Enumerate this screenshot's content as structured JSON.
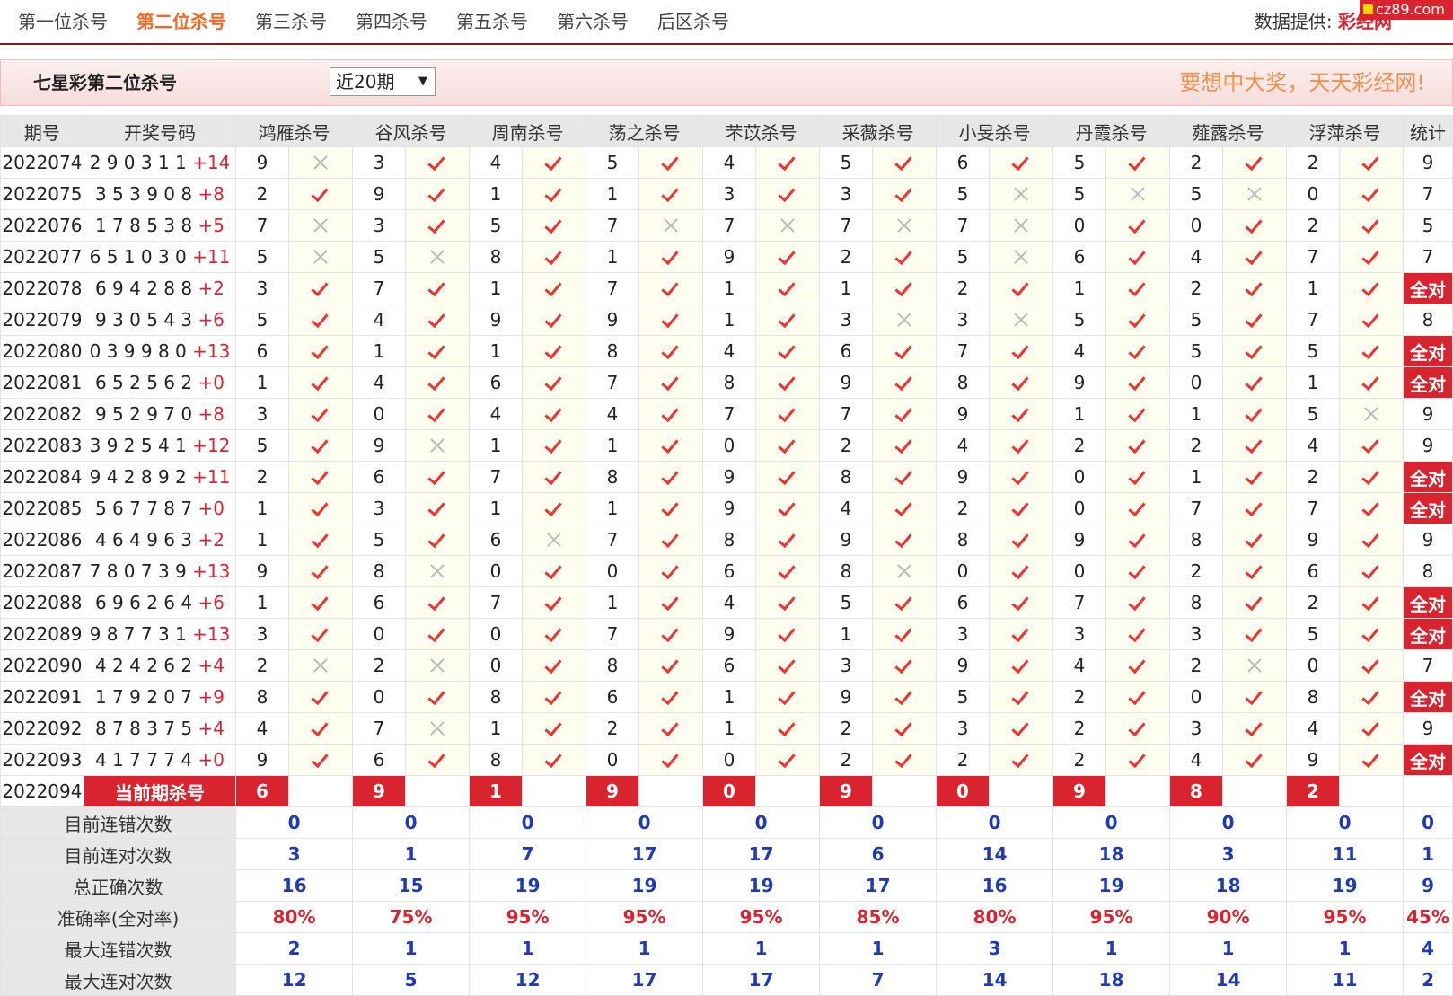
{
  "nav": {
    "tabs": [
      {
        "label": "第一位杀号",
        "active": false
      },
      {
        "label": "第二位杀号",
        "active": true
      },
      {
        "label": "第三杀号",
        "active": false
      },
      {
        "label": "第四杀号",
        "active": false
      },
      {
        "label": "第五杀号",
        "active": false
      },
      {
        "label": "第六杀号",
        "active": false
      },
      {
        "label": "后区杀号",
        "active": false
      }
    ],
    "provider_label": "数据提供:",
    "provider_name": "彩经网",
    "badge": "cz89.com"
  },
  "header": {
    "title": "七星彩第二位杀号",
    "period_select": "近20期",
    "slogan": "要想中大奖，天天彩经网!"
  },
  "table": {
    "col_issue": "期号",
    "col_draw": "开奖号码",
    "col_stat": "统计",
    "experts": [
      "鸿雁杀号",
      "谷风杀号",
      "周南杀号",
      "荡之杀号",
      "芣苡杀号",
      "采薇杀号",
      "小旻杀号",
      "丹霞杀号",
      "薤露杀号",
      "浮萍杀号"
    ],
    "all_right_label": "全对",
    "icons": {
      "right": "check-icon",
      "wrong": "cross-icon"
    },
    "rows": [
      {
        "issue": "2022074",
        "nums": "2 9 0 3 1 1",
        "sp": "+14",
        "picks": [
          "9",
          "3",
          "4",
          "5",
          "4",
          "5",
          "6",
          "5",
          "2",
          "2"
        ],
        "ok": [
          0,
          1,
          1,
          1,
          1,
          1,
          1,
          1,
          1,
          1
        ],
        "stat": "9"
      },
      {
        "issue": "2022075",
        "nums": "3 5 3 9 0 8",
        "sp": "+8",
        "picks": [
          "2",
          "9",
          "1",
          "1",
          "3",
          "3",
          "5",
          "5",
          "5",
          "0"
        ],
        "ok": [
          1,
          1,
          1,
          1,
          1,
          1,
          0,
          0,
          0,
          1
        ],
        "stat": "7"
      },
      {
        "issue": "2022076",
        "nums": "1 7 8 5 3 8",
        "sp": "+5",
        "picks": [
          "7",
          "3",
          "5",
          "7",
          "7",
          "7",
          "7",
          "0",
          "0",
          "2"
        ],
        "ok": [
          0,
          1,
          1,
          0,
          0,
          0,
          0,
          1,
          1,
          1
        ],
        "stat": "5"
      },
      {
        "issue": "2022077",
        "nums": "6 5 1 0 3 0",
        "sp": "+11",
        "picks": [
          "5",
          "5",
          "8",
          "1",
          "9",
          "2",
          "5",
          "6",
          "4",
          "7"
        ],
        "ok": [
          0,
          0,
          1,
          1,
          1,
          1,
          0,
          1,
          1,
          1
        ],
        "stat": "7"
      },
      {
        "issue": "2022078",
        "nums": "6 9 4 2 8 8",
        "sp": "+2",
        "picks": [
          "3",
          "7",
          "1",
          "7",
          "1",
          "1",
          "2",
          "1",
          "2",
          "1"
        ],
        "ok": [
          1,
          1,
          1,
          1,
          1,
          1,
          1,
          1,
          1,
          1
        ],
        "stat": "全对"
      },
      {
        "issue": "2022079",
        "nums": "9 3 0 5 4 3",
        "sp": "+6",
        "picks": [
          "5",
          "4",
          "9",
          "9",
          "1",
          "3",
          "3",
          "5",
          "5",
          "7"
        ],
        "ok": [
          1,
          1,
          1,
          1,
          1,
          0,
          0,
          1,
          1,
          1
        ],
        "stat": "8"
      },
      {
        "issue": "2022080",
        "nums": "0 3 9 9 8 0",
        "sp": "+13",
        "picks": [
          "6",
          "1",
          "1",
          "8",
          "4",
          "6",
          "7",
          "4",
          "5",
          "5"
        ],
        "ok": [
          1,
          1,
          1,
          1,
          1,
          1,
          1,
          1,
          1,
          1
        ],
        "stat": "全对"
      },
      {
        "issue": "2022081",
        "nums": "6 5 2 5 6 2",
        "sp": "+0",
        "picks": [
          "1",
          "4",
          "6",
          "7",
          "8",
          "9",
          "8",
          "9",
          "0",
          "1"
        ],
        "ok": [
          1,
          1,
          1,
          1,
          1,
          1,
          1,
          1,
          1,
          1
        ],
        "stat": "全对"
      },
      {
        "issue": "2022082",
        "nums": "9 5 2 9 7 0",
        "sp": "+8",
        "picks": [
          "3",
          "0",
          "4",
          "4",
          "7",
          "7",
          "9",
          "1",
          "1",
          "5"
        ],
        "ok": [
          1,
          1,
          1,
          1,
          1,
          1,
          1,
          1,
          1,
          0
        ],
        "stat": "9"
      },
      {
        "issue": "2022083",
        "nums": "3 9 2 5 4 1",
        "sp": "+12",
        "picks": [
          "5",
          "9",
          "1",
          "1",
          "0",
          "2",
          "4",
          "2",
          "2",
          "4"
        ],
        "ok": [
          1,
          0,
          1,
          1,
          1,
          1,
          1,
          1,
          1,
          1
        ],
        "stat": "9"
      },
      {
        "issue": "2022084",
        "nums": "9 4 2 8 9 2",
        "sp": "+11",
        "picks": [
          "2",
          "6",
          "7",
          "8",
          "9",
          "8",
          "9",
          "0",
          "1",
          "2"
        ],
        "ok": [
          1,
          1,
          1,
          1,
          1,
          1,
          1,
          1,
          1,
          1
        ],
        "stat": "全对"
      },
      {
        "issue": "2022085",
        "nums": "5 6 7 7 8 7",
        "sp": "+0",
        "picks": [
          "1",
          "3",
          "1",
          "1",
          "9",
          "4",
          "2",
          "0",
          "7",
          "7"
        ],
        "ok": [
          1,
          1,
          1,
          1,
          1,
          1,
          1,
          1,
          1,
          1
        ],
        "stat": "全对"
      },
      {
        "issue": "2022086",
        "nums": "4 6 4 9 6 3",
        "sp": "+2",
        "picks": [
          "1",
          "5",
          "6",
          "7",
          "8",
          "9",
          "8",
          "9",
          "8",
          "9"
        ],
        "ok": [
          1,
          1,
          0,
          1,
          1,
          1,
          1,
          1,
          1,
          1
        ],
        "stat": "9"
      },
      {
        "issue": "2022087",
        "nums": "7 8 0 7 3 9",
        "sp": "+13",
        "picks": [
          "9",
          "8",
          "0",
          "0",
          "6",
          "8",
          "0",
          "0",
          "2",
          "6"
        ],
        "ok": [
          1,
          0,
          1,
          1,
          1,
          0,
          1,
          1,
          1,
          1
        ],
        "stat": "8"
      },
      {
        "issue": "2022088",
        "nums": "6 9 6 2 6 4",
        "sp": "+6",
        "picks": [
          "1",
          "6",
          "7",
          "1",
          "4",
          "5",
          "6",
          "7",
          "8",
          "2"
        ],
        "ok": [
          1,
          1,
          1,
          1,
          1,
          1,
          1,
          1,
          1,
          1
        ],
        "stat": "全对"
      },
      {
        "issue": "2022089",
        "nums": "9 8 7 7 3 1",
        "sp": "+13",
        "picks": [
          "3",
          "0",
          "0",
          "7",
          "9",
          "1",
          "3",
          "3",
          "3",
          "5"
        ],
        "ok": [
          1,
          1,
          1,
          1,
          1,
          1,
          1,
          1,
          1,
          1
        ],
        "stat": "全对"
      },
      {
        "issue": "2022090",
        "nums": "4 2 4 2 6 2",
        "sp": "+4",
        "picks": [
          "2",
          "2",
          "0",
          "8",
          "6",
          "3",
          "9",
          "4",
          "2",
          "0"
        ],
        "ok": [
          0,
          0,
          1,
          1,
          1,
          1,
          1,
          1,
          0,
          1
        ],
        "stat": "7"
      },
      {
        "issue": "2022091",
        "nums": "1 7 9 2 0 7",
        "sp": "+9",
        "picks": [
          "8",
          "0",
          "8",
          "6",
          "1",
          "9",
          "5",
          "2",
          "0",
          "8"
        ],
        "ok": [
          1,
          1,
          1,
          1,
          1,
          1,
          1,
          1,
          1,
          1
        ],
        "stat": "全对"
      },
      {
        "issue": "2022092",
        "nums": "8 7 8 3 7 5",
        "sp": "+4",
        "picks": [
          "4",
          "7",
          "1",
          "2",
          "1",
          "2",
          "3",
          "2",
          "3",
          "4"
        ],
        "ok": [
          1,
          0,
          1,
          1,
          1,
          1,
          1,
          1,
          1,
          1
        ],
        "stat": "9"
      },
      {
        "issue": "2022093",
        "nums": "4 1 7 7 7 4",
        "sp": "+0",
        "picks": [
          "9",
          "6",
          "8",
          "0",
          "0",
          "2",
          "2",
          "2",
          "4",
          "9"
        ],
        "ok": [
          1,
          1,
          1,
          1,
          1,
          1,
          1,
          1,
          1,
          1
        ],
        "stat": "全对"
      }
    ],
    "current": {
      "issue": "2022094",
      "label": "当前期杀号",
      "picks": [
        "6",
        "9",
        "1",
        "9",
        "0",
        "9",
        "0",
        "9",
        "8",
        "2"
      ]
    },
    "stats": [
      {
        "label": "目前连错次数",
        "values": [
          "0",
          "0",
          "0",
          "0",
          "0",
          "0",
          "0",
          "0",
          "0",
          "0"
        ],
        "total": "0",
        "color": "blue"
      },
      {
        "label": "目前连对次数",
        "values": [
          "3",
          "1",
          "7",
          "17",
          "17",
          "6",
          "14",
          "18",
          "3",
          "11"
        ],
        "total": "1",
        "color": "blue"
      },
      {
        "label": "总正确次数",
        "values": [
          "16",
          "15",
          "19",
          "19",
          "19",
          "17",
          "16",
          "19",
          "18",
          "19"
        ],
        "total": "9",
        "color": "blue"
      },
      {
        "label": "准确率(全对率)",
        "values": [
          "80%",
          "75%",
          "95%",
          "95%",
          "95%",
          "85%",
          "80%",
          "95%",
          "90%",
          "95%"
        ],
        "total": "45%",
        "color": "red"
      },
      {
        "label": "最大连错次数",
        "values": [
          "2",
          "1",
          "1",
          "1",
          "1",
          "1",
          "3",
          "1",
          "1",
          "1"
        ],
        "total": "4",
        "color": "blue"
      },
      {
        "label": "最大连对次数",
        "values": [
          "12",
          "5",
          "12",
          "17",
          "17",
          "7",
          "14",
          "18",
          "14",
          "11"
        ],
        "total": "2",
        "color": "blue"
      }
    ]
  }
}
